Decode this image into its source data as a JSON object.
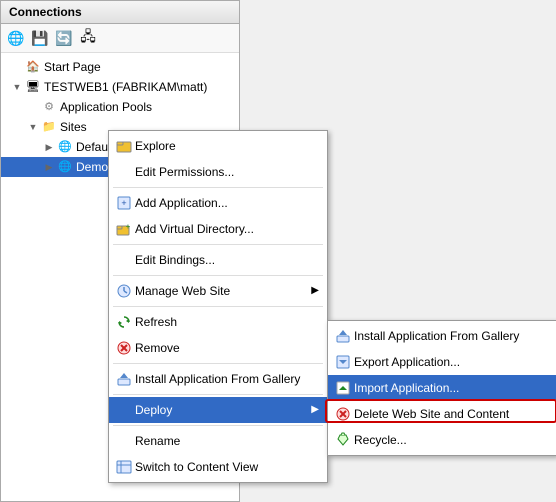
{
  "panel": {
    "title": "Connections",
    "toolbar": {
      "back_icon": "◀",
      "forward_icon": "▶",
      "save_icon": "💾",
      "refresh_icon": "🌐"
    }
  },
  "tree": {
    "items": [
      {
        "id": "start-page",
        "label": "Start Page",
        "indent": 0,
        "icon": "🏠",
        "expanded": false
      },
      {
        "id": "server",
        "label": "TESTWEB1 (FABRIKAM\\matt)",
        "indent": 0,
        "icon": "🖥",
        "expanded": true
      },
      {
        "id": "app-pools",
        "label": "Application Pools",
        "indent": 1,
        "icon": "⚙",
        "expanded": false
      },
      {
        "id": "sites",
        "label": "Sites",
        "indent": 1,
        "icon": "📁",
        "expanded": true
      },
      {
        "id": "default-web",
        "label": "Default Web Site",
        "indent": 2,
        "icon": "🌐",
        "expanded": false
      },
      {
        "id": "demosite",
        "label": "DemoSite",
        "indent": 2,
        "icon": "🌐",
        "expanded": false,
        "selected": true
      }
    ]
  },
  "context_menu": {
    "items": [
      {
        "id": "explore",
        "label": "Explore",
        "icon": "📁",
        "has_icon": true
      },
      {
        "id": "edit-permissions",
        "label": "Edit Permissions...",
        "icon": "",
        "has_icon": false
      },
      {
        "id": "sep1",
        "type": "separator"
      },
      {
        "id": "add-application",
        "label": "Add Application...",
        "icon": "📄",
        "has_icon": true
      },
      {
        "id": "add-virtual-dir",
        "label": "Add Virtual Directory...",
        "icon": "📂",
        "has_icon": true
      },
      {
        "id": "sep2",
        "type": "separator"
      },
      {
        "id": "edit-bindings",
        "label": "Edit Bindings...",
        "icon": "",
        "has_icon": false
      },
      {
        "id": "sep3",
        "type": "separator"
      },
      {
        "id": "manage-web-site",
        "label": "Manage Web Site",
        "icon": "⚙",
        "has_icon": true,
        "has_arrow": true
      },
      {
        "id": "sep4",
        "type": "separator"
      },
      {
        "id": "refresh",
        "label": "Refresh",
        "icon": "🔄",
        "has_icon": true
      },
      {
        "id": "remove",
        "label": "Remove",
        "icon": "✖",
        "has_icon": true
      },
      {
        "id": "sep5",
        "type": "separator"
      },
      {
        "id": "install-from-gallery",
        "label": "Install Application From Gallery",
        "icon": "📦",
        "has_icon": true
      },
      {
        "id": "sep6",
        "type": "separator"
      },
      {
        "id": "deploy",
        "label": "Deploy",
        "icon": "🚀",
        "has_icon": false,
        "has_arrow": true,
        "highlighted": true
      },
      {
        "id": "sep7",
        "type": "separator"
      },
      {
        "id": "rename",
        "label": "Rename",
        "icon": "",
        "has_icon": false
      },
      {
        "id": "switch-content-view",
        "label": "Switch to Content View",
        "icon": "📋",
        "has_icon": true
      }
    ]
  },
  "submenu": {
    "items": [
      {
        "id": "install-gallery-sub",
        "label": "Install Application From Gallery",
        "icon": "📦"
      },
      {
        "id": "export-app",
        "label": "Export Application...",
        "icon": "📤"
      },
      {
        "id": "import-app",
        "label": "Import Application...",
        "icon": "📥",
        "highlighted": true
      },
      {
        "id": "delete-web-content",
        "label": "Delete Web Site and Content",
        "icon": "✖"
      },
      {
        "id": "recycle",
        "label": "Recycle...",
        "icon": "♻"
      }
    ]
  }
}
